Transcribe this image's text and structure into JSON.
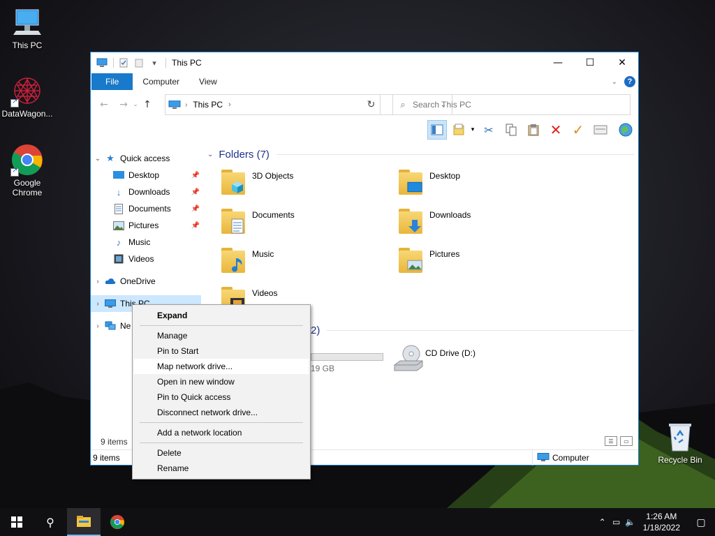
{
  "desktop": {
    "icons": [
      {
        "label": "This PC",
        "icon": "monitor-icon"
      },
      {
        "label": "DataWagon...",
        "icon": "datawagon-icon"
      },
      {
        "label": "Google Chrome",
        "icon": "chrome-icon"
      },
      {
        "label": "Recycle Bin",
        "icon": "recycle-bin-icon"
      }
    ]
  },
  "window": {
    "title": "This PC",
    "tabs": {
      "file": "File",
      "computer": "Computer",
      "view": "View"
    },
    "address": {
      "location": "This PC"
    },
    "search": {
      "placeholder": "Search This PC"
    },
    "nav": {
      "quick_access": "Quick access",
      "desktop": "Desktop",
      "downloads": "Downloads",
      "documents": "Documents",
      "pictures": "Pictures",
      "music": "Music",
      "videos": "Videos",
      "onedrive": "OneDrive",
      "this_pc": "This PC",
      "network": "Ne"
    },
    "content": {
      "folders_header": "Folders (7)",
      "folders": {
        "objects3d": "3D Objects",
        "desktop": "Desktop",
        "documents": "Documents",
        "downloads": "Downloads",
        "music": "Music",
        "pictures": "Pictures",
        "videos": "Videos"
      },
      "devices_header_fragment": "2)",
      "drive_c_size_fragment": "19 GB",
      "drive_d_label": "CD Drive (D:)"
    },
    "item_count_inner": "9 items",
    "status": {
      "left": "9 items",
      "right": "Computer"
    }
  },
  "context_menu": {
    "expand": "Expand",
    "manage": "Manage",
    "pin_start": "Pin to Start",
    "map_drive": "Map network drive...",
    "open_new": "Open in new window",
    "pin_quick": "Pin to Quick access",
    "disconnect": "Disconnect network drive...",
    "add_location": "Add a network location",
    "delete": "Delete",
    "rename": "Rename"
  },
  "taskbar": {
    "time": "1:26 AM",
    "date": "1/18/2022"
  },
  "colors": {
    "accent": "#1979ca",
    "folder_header": "#1e3287",
    "selection": "#cce8ff"
  }
}
